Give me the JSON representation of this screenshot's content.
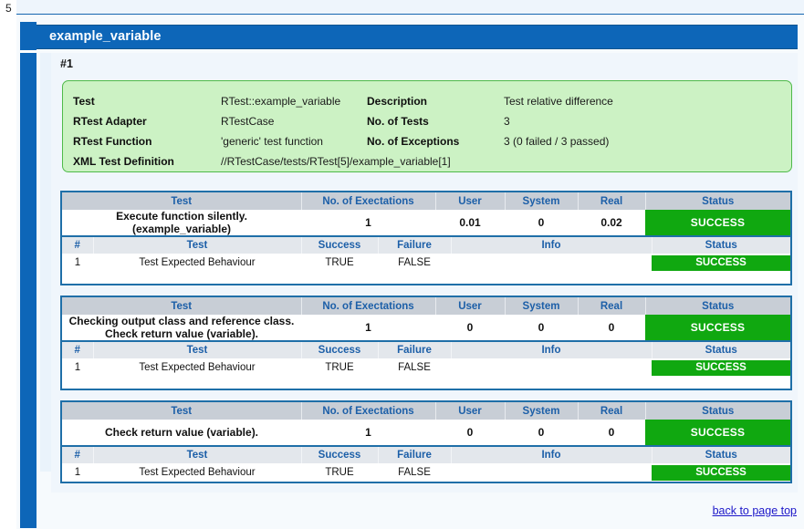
{
  "page": {
    "number": "5",
    "title": "example_variable",
    "run_label": "#1",
    "back_link": "back to page top"
  },
  "summary": {
    "rows": [
      {
        "key": "Test",
        "value": "RTest::example_variable",
        "key2": "Description",
        "value2": "Test relative difference"
      },
      {
        "key": "RTest Adapter",
        "value": "RTestCase",
        "key2": "No. of Tests",
        "value2": "3"
      },
      {
        "key": "RTest Function",
        "value": "'generic' test function",
        "key2": "No. of Exceptions",
        "value2": "3 (0 failed / 3 passed)"
      }
    ],
    "xml_key": "XML Test Definition",
    "xml_value": "//RTestCase/tests/RTest[5]/example_variable[1]"
  },
  "outer_headers": {
    "test": "Test",
    "expectations": "No. of Exectations",
    "user": "User",
    "system": "System",
    "real": "Real",
    "status": "Status"
  },
  "inner_headers": {
    "num": "#",
    "test": "Test",
    "success": "Success",
    "failure": "Failure",
    "info": "Info",
    "status": "Status"
  },
  "blocks": [
    {
      "description_line1": "Execute function silently.",
      "description_line2": "(example_variable)",
      "expectations": "1",
      "user": "0.01",
      "system": "0",
      "real": "0.02",
      "status": "SUCCESS",
      "detail": {
        "num": "1",
        "test": "Test Expected Behaviour",
        "success": "TRUE",
        "failure": "FALSE",
        "info": "",
        "status": "SUCCESS"
      }
    },
    {
      "description_line1": "Checking output class and reference class.",
      "description_line2": "Check return value (variable).",
      "expectations": "1",
      "user": "0",
      "system": "0",
      "real": "0",
      "status": "SUCCESS",
      "detail": {
        "num": "1",
        "test": "Test Expected Behaviour",
        "success": "TRUE",
        "failure": "FALSE",
        "info": "",
        "status": "SUCCESS"
      }
    },
    {
      "description_line1": "Check return value (variable).",
      "description_line2": "",
      "expectations": "1",
      "user": "0",
      "system": "0",
      "real": "0",
      "status": "SUCCESS",
      "detail": {
        "num": "1",
        "test": "Test Expected Behaviour",
        "success": "TRUE",
        "failure": "FALSE",
        "info": "",
        "status": "SUCCESS"
      }
    }
  ],
  "colors": {
    "brand_blue": "#0d66b8",
    "header_link_blue": "#1c5fa8",
    "success_green": "#10a810",
    "summary_green_bg": "#ccf2c4",
    "summary_green_border": "#4fba4a",
    "link_purple": "#1c17c9"
  }
}
